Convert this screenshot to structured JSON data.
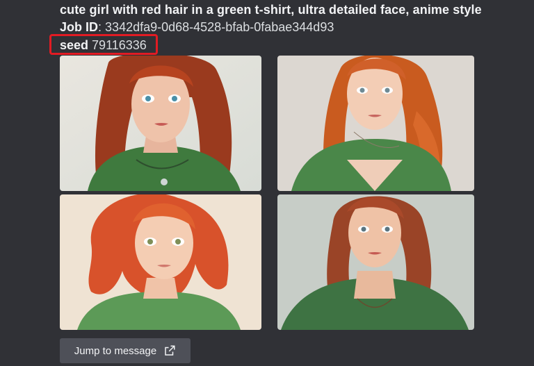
{
  "message": {
    "prompt": "cute girl with red hair in a green t-shirt, ultra detailed face, anime style",
    "job_id_label": "Job ID",
    "job_id_separator": ":",
    "job_id_value": "3342dfa9-0d68-4528-bfab-0fabae344d93",
    "seed_label": "seed",
    "seed_value": "79116336"
  },
  "colors": {
    "background": "#303136",
    "highlight_border": "#e21b23",
    "button_bg": "#4e5058"
  },
  "images": [
    {
      "icon": "generated-image-1"
    },
    {
      "icon": "generated-image-2"
    },
    {
      "icon": "generated-image-3"
    },
    {
      "icon": "generated-image-4"
    }
  ],
  "actions": {
    "jump_label": "Jump to message",
    "jump_icon": "external-link-icon"
  }
}
